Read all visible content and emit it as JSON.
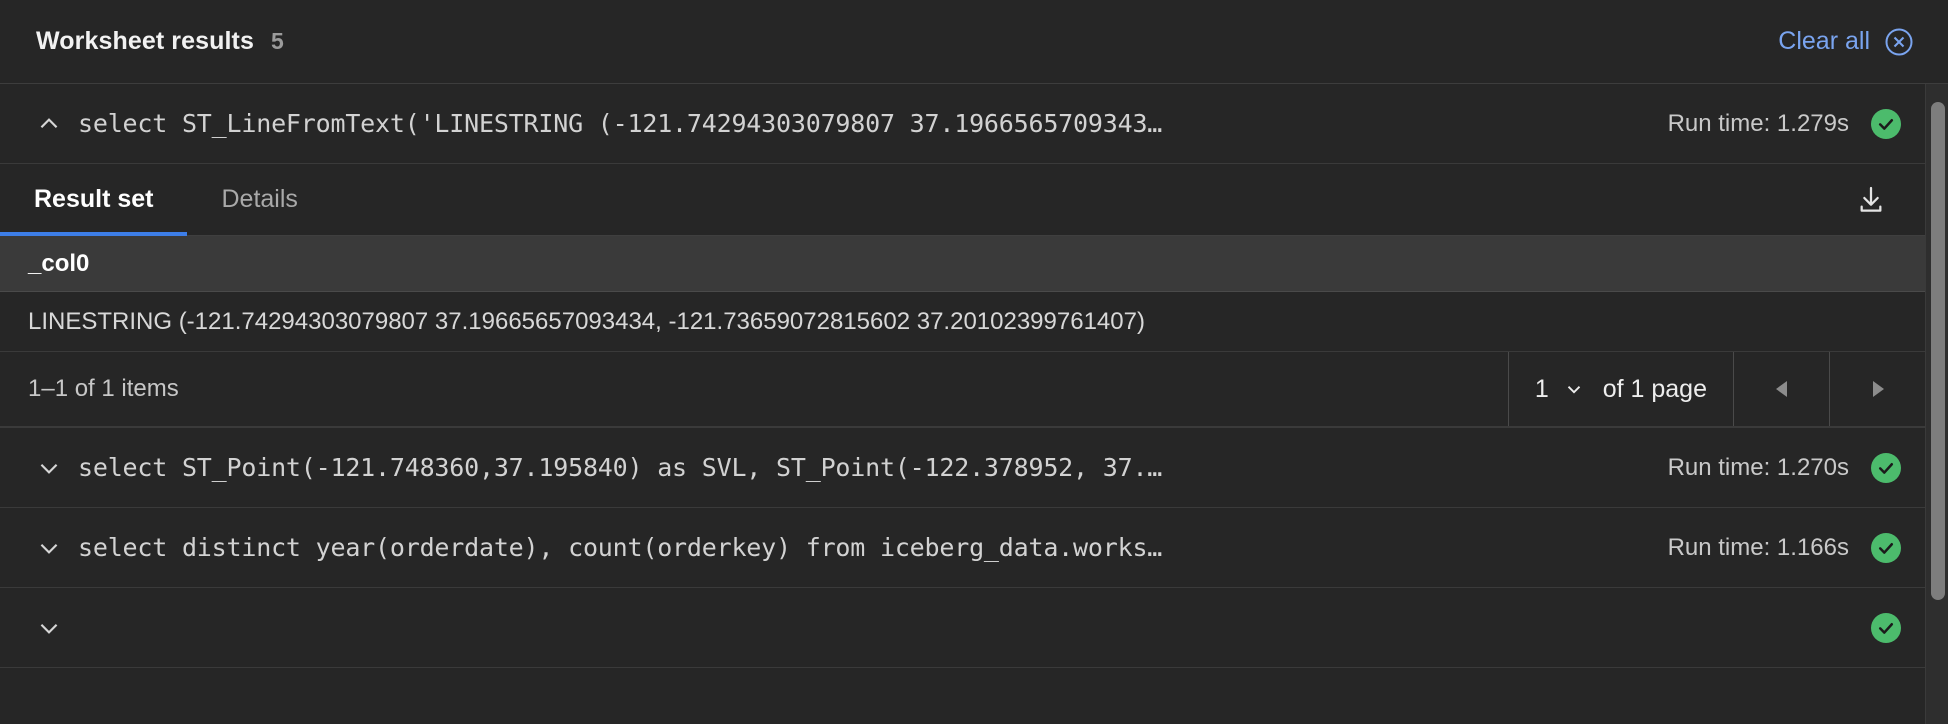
{
  "header": {
    "title": "Worksheet results",
    "count": "5",
    "clear_all_label": "Clear all",
    "clear_all_icon": "close-circle-icon",
    "accent_blue": "#7aa4ef"
  },
  "results": [
    {
      "expanded": true,
      "chevron": "chevron-up-icon",
      "query": "select ST_LineFromText('LINESTRING (-121.74294303079807 37.1966565709343…",
      "run_time": "Run time: 1.279s",
      "status": "success",
      "status_color": "#4cbb6c",
      "tabs": [
        {
          "label": "Result set",
          "active": true
        },
        {
          "label": "Details",
          "active": false
        }
      ],
      "download_icon": "download-icon",
      "table": {
        "columns": [
          "_col0"
        ],
        "rows": [
          [
            "LINESTRING (-121.74294303079807 37.19665657093434, -121.73659072815602 37.20102399761407)"
          ]
        ]
      },
      "pagination": {
        "items_label": "1–1 of 1 items",
        "page_value": "1",
        "page_select_icon": "chevron-down-icon",
        "of_pages_label": "of 1 page",
        "prev_icon": "triangle-left-icon",
        "next_icon": "triangle-right-icon"
      }
    },
    {
      "expanded": false,
      "chevron": "chevron-down-icon",
      "query": "select ST_Point(-121.748360,37.195840) as SVL, ST_Point(-122.378952, 37.…",
      "run_time": "Run time: 1.270s",
      "status": "success",
      "status_color": "#4cbb6c"
    },
    {
      "expanded": false,
      "chevron": "chevron-down-icon",
      "query": "select distinct year(orderdate), count(orderkey) from iceberg_data.works…",
      "run_time": "Run time: 1.166s",
      "status": "success",
      "status_color": "#4cbb6c"
    },
    {
      "expanded": false,
      "chevron": "chevron-down-icon",
      "query": "",
      "run_time": "",
      "status": "success",
      "status_color": "#4cbb6c"
    }
  ]
}
